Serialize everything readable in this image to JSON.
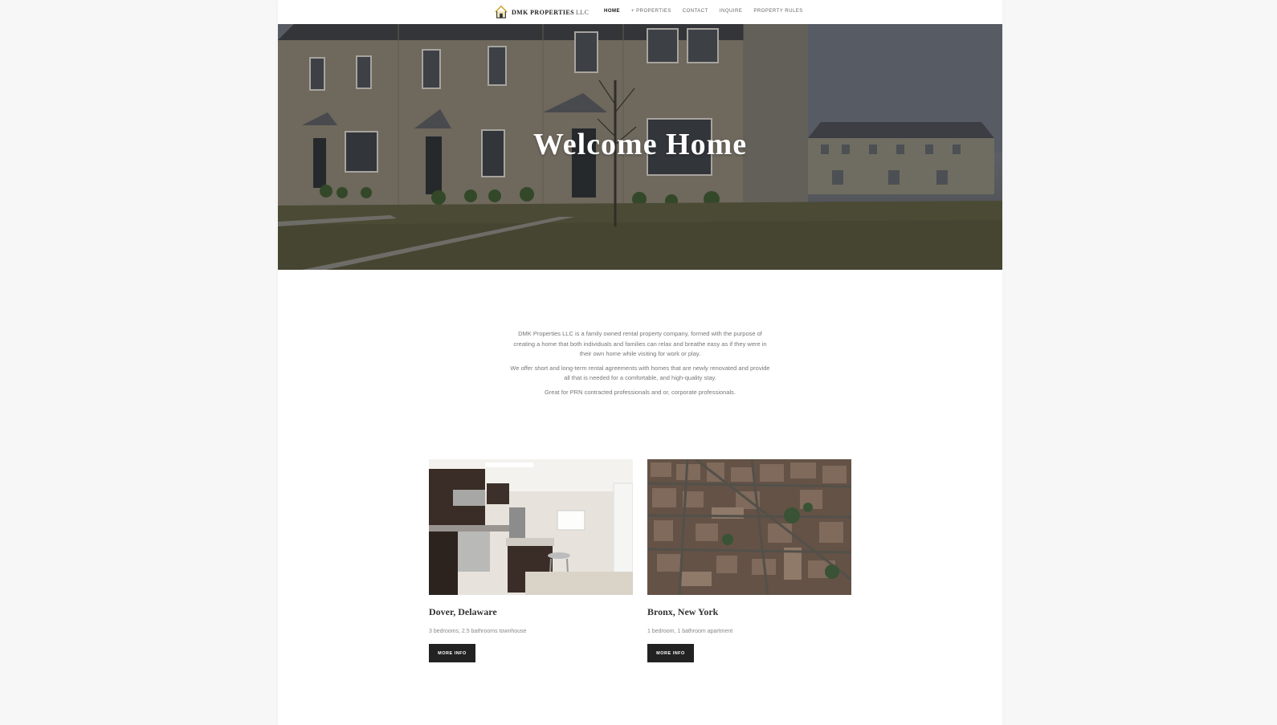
{
  "brand": {
    "name": "DMK PROPERTIES",
    "suffix": "LLC",
    "logo_icon": "house-icon",
    "accent": "#c9a227"
  },
  "nav": {
    "items": [
      {
        "label": "HOME",
        "active": true
      },
      {
        "label": "+ PROPERTIES",
        "active": false
      },
      {
        "label": "CONTACT",
        "active": false
      },
      {
        "label": "INQUIRE",
        "active": false
      },
      {
        "label": "PROPERTY RULES",
        "active": false
      }
    ]
  },
  "hero": {
    "title": "Welcome Home"
  },
  "intro": {
    "paragraphs": [
      "DMK Properties LLC is a family owned rental property company, formed with the purpose of creating a home that both individuals and families can relax and breathe easy as if they were in their own home while visiting for work or play.",
      "We offer short and long-term rental agreements with homes that are newly renovated and provide all that is needed for a comfortable, and high-quality stay.",
      "Great for PRN contracted professionals and or, corporate professionals."
    ]
  },
  "properties": [
    {
      "title": "Dover, Delaware",
      "description": "3 bedrooms, 2.5 bathrooms townhouse",
      "button": "MORE INFO"
    },
    {
      "title": "Bronx, New York",
      "description": "1 bedroom, 1 bathroom apartment",
      "button": "MORE INFO"
    }
  ]
}
